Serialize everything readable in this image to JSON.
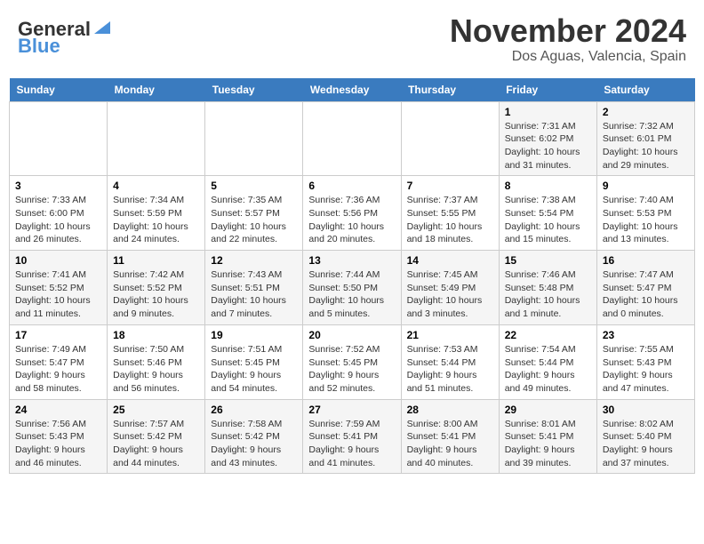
{
  "header": {
    "logo_line1": "General",
    "logo_line2": "Blue",
    "month": "November 2024",
    "location": "Dos Aguas, Valencia, Spain"
  },
  "days_of_week": [
    "Sunday",
    "Monday",
    "Tuesday",
    "Wednesday",
    "Thursday",
    "Friday",
    "Saturday"
  ],
  "weeks": [
    [
      {
        "day": "",
        "info": ""
      },
      {
        "day": "",
        "info": ""
      },
      {
        "day": "",
        "info": ""
      },
      {
        "day": "",
        "info": ""
      },
      {
        "day": "",
        "info": ""
      },
      {
        "day": "1",
        "info": "Sunrise: 7:31 AM\nSunset: 6:02 PM\nDaylight: 10 hours\nand 31 minutes."
      },
      {
        "day": "2",
        "info": "Sunrise: 7:32 AM\nSunset: 6:01 PM\nDaylight: 10 hours\nand 29 minutes."
      }
    ],
    [
      {
        "day": "3",
        "info": "Sunrise: 7:33 AM\nSunset: 6:00 PM\nDaylight: 10 hours\nand 26 minutes."
      },
      {
        "day": "4",
        "info": "Sunrise: 7:34 AM\nSunset: 5:59 PM\nDaylight: 10 hours\nand 24 minutes."
      },
      {
        "day": "5",
        "info": "Sunrise: 7:35 AM\nSunset: 5:57 PM\nDaylight: 10 hours\nand 22 minutes."
      },
      {
        "day": "6",
        "info": "Sunrise: 7:36 AM\nSunset: 5:56 PM\nDaylight: 10 hours\nand 20 minutes."
      },
      {
        "day": "7",
        "info": "Sunrise: 7:37 AM\nSunset: 5:55 PM\nDaylight: 10 hours\nand 18 minutes."
      },
      {
        "day": "8",
        "info": "Sunrise: 7:38 AM\nSunset: 5:54 PM\nDaylight: 10 hours\nand 15 minutes."
      },
      {
        "day": "9",
        "info": "Sunrise: 7:40 AM\nSunset: 5:53 PM\nDaylight: 10 hours\nand 13 minutes."
      }
    ],
    [
      {
        "day": "10",
        "info": "Sunrise: 7:41 AM\nSunset: 5:52 PM\nDaylight: 10 hours\nand 11 minutes."
      },
      {
        "day": "11",
        "info": "Sunrise: 7:42 AM\nSunset: 5:52 PM\nDaylight: 10 hours\nand 9 minutes."
      },
      {
        "day": "12",
        "info": "Sunrise: 7:43 AM\nSunset: 5:51 PM\nDaylight: 10 hours\nand 7 minutes."
      },
      {
        "day": "13",
        "info": "Sunrise: 7:44 AM\nSunset: 5:50 PM\nDaylight: 10 hours\nand 5 minutes."
      },
      {
        "day": "14",
        "info": "Sunrise: 7:45 AM\nSunset: 5:49 PM\nDaylight: 10 hours\nand 3 minutes."
      },
      {
        "day": "15",
        "info": "Sunrise: 7:46 AM\nSunset: 5:48 PM\nDaylight: 10 hours\nand 1 minute."
      },
      {
        "day": "16",
        "info": "Sunrise: 7:47 AM\nSunset: 5:47 PM\nDaylight: 10 hours\nand 0 minutes."
      }
    ],
    [
      {
        "day": "17",
        "info": "Sunrise: 7:49 AM\nSunset: 5:47 PM\nDaylight: 9 hours\nand 58 minutes."
      },
      {
        "day": "18",
        "info": "Sunrise: 7:50 AM\nSunset: 5:46 PM\nDaylight: 9 hours\nand 56 minutes."
      },
      {
        "day": "19",
        "info": "Sunrise: 7:51 AM\nSunset: 5:45 PM\nDaylight: 9 hours\nand 54 minutes."
      },
      {
        "day": "20",
        "info": "Sunrise: 7:52 AM\nSunset: 5:45 PM\nDaylight: 9 hours\nand 52 minutes."
      },
      {
        "day": "21",
        "info": "Sunrise: 7:53 AM\nSunset: 5:44 PM\nDaylight: 9 hours\nand 51 minutes."
      },
      {
        "day": "22",
        "info": "Sunrise: 7:54 AM\nSunset: 5:44 PM\nDaylight: 9 hours\nand 49 minutes."
      },
      {
        "day": "23",
        "info": "Sunrise: 7:55 AM\nSunset: 5:43 PM\nDaylight: 9 hours\nand 47 minutes."
      }
    ],
    [
      {
        "day": "24",
        "info": "Sunrise: 7:56 AM\nSunset: 5:43 PM\nDaylight: 9 hours\nand 46 minutes."
      },
      {
        "day": "25",
        "info": "Sunrise: 7:57 AM\nSunset: 5:42 PM\nDaylight: 9 hours\nand 44 minutes."
      },
      {
        "day": "26",
        "info": "Sunrise: 7:58 AM\nSunset: 5:42 PM\nDaylight: 9 hours\nand 43 minutes."
      },
      {
        "day": "27",
        "info": "Sunrise: 7:59 AM\nSunset: 5:41 PM\nDaylight: 9 hours\nand 41 minutes."
      },
      {
        "day": "28",
        "info": "Sunrise: 8:00 AM\nSunset: 5:41 PM\nDaylight: 9 hours\nand 40 minutes."
      },
      {
        "day": "29",
        "info": "Sunrise: 8:01 AM\nSunset: 5:41 PM\nDaylight: 9 hours\nand 39 minutes."
      },
      {
        "day": "30",
        "info": "Sunrise: 8:02 AM\nSunset: 5:40 PM\nDaylight: 9 hours\nand 37 minutes."
      }
    ]
  ]
}
